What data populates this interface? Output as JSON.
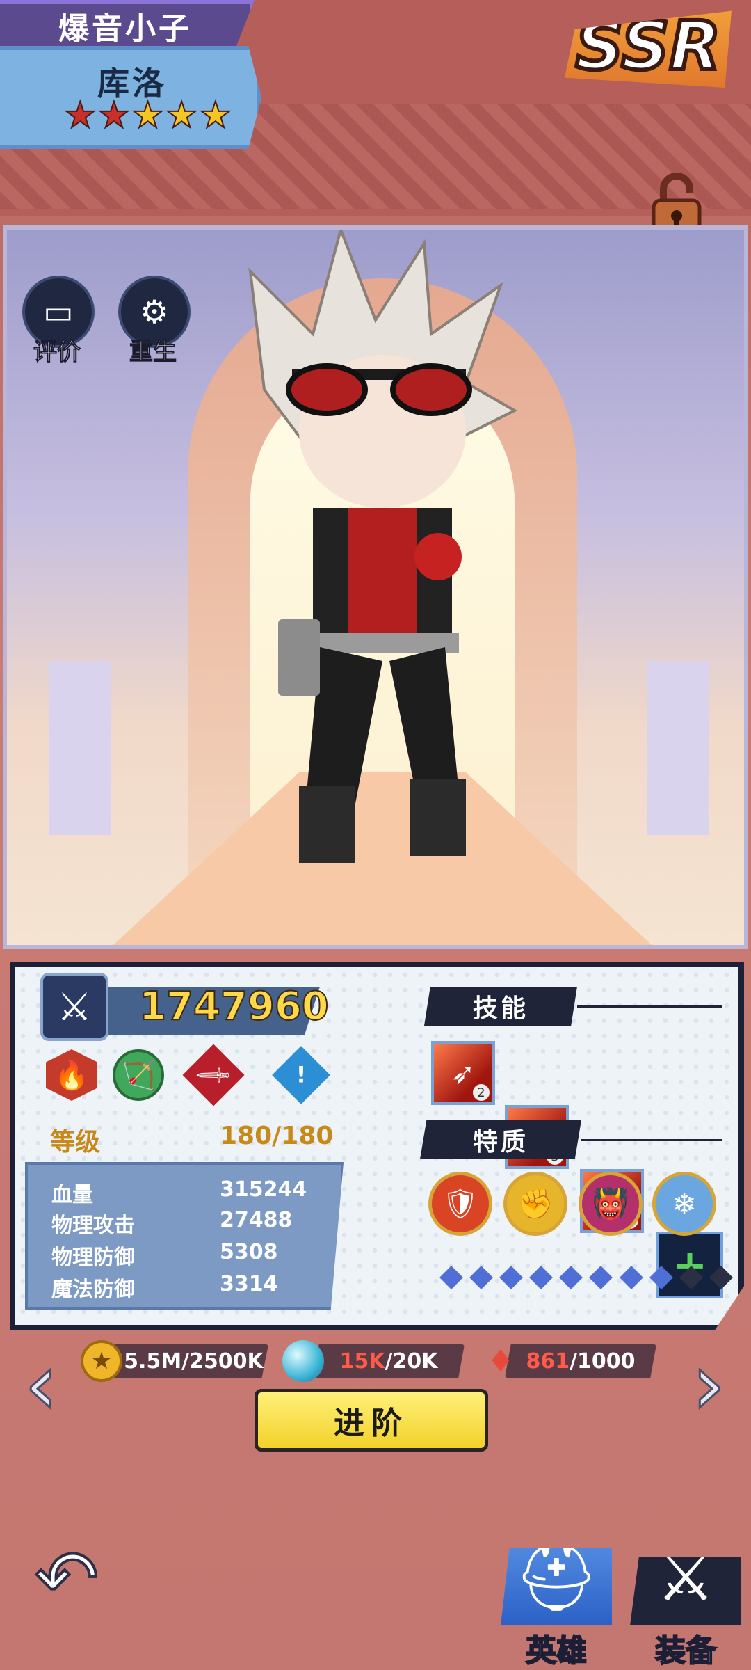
{
  "header": {
    "title": "爆音小子",
    "hero_name": "库洛",
    "stars": [
      {
        "color": "#c9302c"
      },
      {
        "color": "#c9302c"
      },
      {
        "color": "#f3c623"
      },
      {
        "color": "#f3c623"
      },
      {
        "color": "#f3c623"
      }
    ],
    "rarity": "SSR"
  },
  "side_buttons": [
    {
      "label": "评价",
      "icon": "chat-icon"
    },
    {
      "label": "重生",
      "icon": "gear-icon"
    }
  ],
  "stats": {
    "combat_power": "1747960",
    "elements": [
      {
        "icon": "fire-icon",
        "color": "#c43b2c"
      },
      {
        "icon": "bow-icon",
        "color": "#3fa85a"
      },
      {
        "icon": "sword-icon",
        "color": "#b81f2a"
      },
      {
        "icon": "info-icon",
        "color": "#2c8fd6"
      }
    ],
    "level_label": "等级",
    "level_value": "180/180",
    "rows": [
      {
        "label": "血量",
        "value": "315244"
      },
      {
        "label": "物理攻击",
        "value": "27488"
      },
      {
        "label": "物理防御",
        "value": "5308"
      },
      {
        "label": "魔法防御",
        "value": "3314"
      }
    ]
  },
  "skills": {
    "title": "技能",
    "items": [
      {
        "icon": "red-bullet-skill-icon",
        "level": "2"
      },
      {
        "icon": "flame-bullet-skill-icon",
        "level": "3"
      },
      {
        "icon": "vortex-skill-icon",
        "level": "3"
      }
    ],
    "add_icon": "plus-icon"
  },
  "traits": {
    "title": "特质",
    "items": [
      {
        "icon": "shield-trait-icon",
        "color": "#d94424"
      },
      {
        "icon": "fist-trait-icon",
        "color": "#e7b52b"
      },
      {
        "icon": "fire-face-trait-icon",
        "color": "#b3306a"
      },
      {
        "icon": "ice-trait-icon",
        "color": "#6aa6e0"
      }
    ],
    "diamonds": [
      {
        "filled": true
      },
      {
        "filled": true
      },
      {
        "filled": true
      },
      {
        "filled": true
      },
      {
        "filled": true
      },
      {
        "filled": true
      },
      {
        "filled": true
      },
      {
        "filled": true
      },
      {
        "filled": false
      },
      {
        "filled": false
      }
    ]
  },
  "resources": {
    "gold": {
      "amount": "35.5M",
      "need": "/2500K"
    },
    "orb": {
      "amount": "15K",
      "need": "/20K"
    },
    "crystal": {
      "amount": "861",
      "need": "/1000"
    }
  },
  "advance_label": "进阶",
  "bottom_tabs": [
    {
      "label": "英雄",
      "icon": "helmet-icon"
    },
    {
      "label": "装备",
      "icon": "crossed-swords-icon"
    }
  ],
  "colors": {
    "background": "#c47770",
    "panel_dark": "#1f2438",
    "gold_text": "#ffd84a",
    "highlight_red": "#e0392f"
  }
}
